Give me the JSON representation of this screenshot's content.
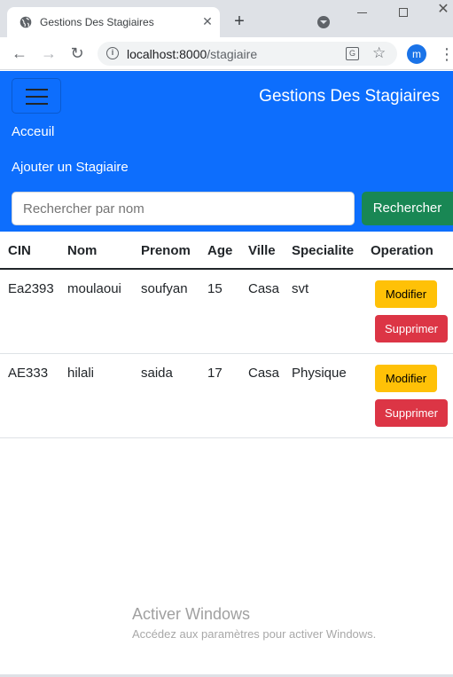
{
  "browser": {
    "tab_title": "Gestions Des Stagiaires",
    "url_host": "localhost:8000",
    "url_path": "/stagiaire",
    "profile_initial": "m"
  },
  "navbar": {
    "brand": "Gestions Des Stagiaires",
    "links": [
      "Acceuil",
      "Ajouter un Stagiaire"
    ],
    "search_placeholder": "Rechercher par nom",
    "search_button": "Rechercher",
    "bg_color": "#0d6efd"
  },
  "table": {
    "headers": [
      "CIN",
      "Nom",
      "Prenom",
      "Age",
      "Ville",
      "Specialite",
      "Operation"
    ],
    "rows": [
      {
        "cin": "Ea2393",
        "nom": "moulaoui",
        "prenom": "soufyan",
        "age": "15",
        "ville": "Casa",
        "specialite": "svt"
      },
      {
        "cin": "AE333",
        "nom": "hilali",
        "prenom": "saida",
        "age": "17",
        "ville": "Casa",
        "specialite": "Physique"
      }
    ],
    "modify_label": "Modifier",
    "delete_label": "Supprimer"
  },
  "watermark": {
    "title": "Activer Windows",
    "subtitle": "Accédez aux paramètres pour activer Windows."
  }
}
